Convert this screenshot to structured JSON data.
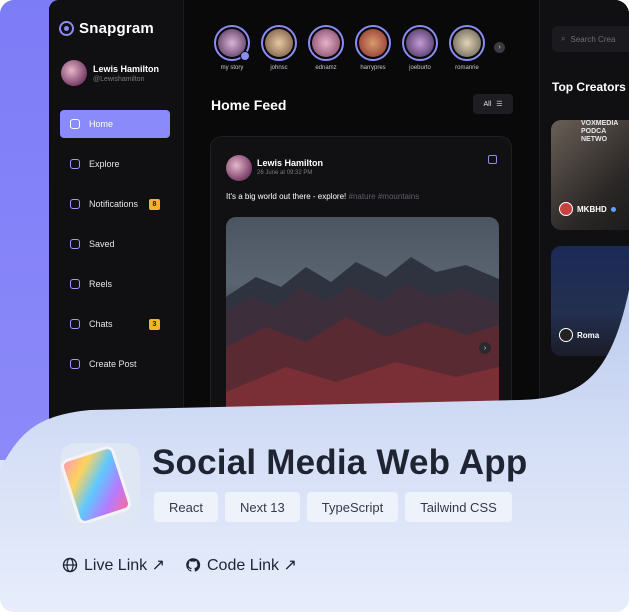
{
  "app": {
    "brand": "Snapgram",
    "profile": {
      "name": "Lewis Hamilton",
      "handle": "@Lewishamilton"
    },
    "nav": [
      {
        "label": "Home",
        "active": true,
        "badge": ""
      },
      {
        "label": "Explore",
        "active": false,
        "badge": ""
      },
      {
        "label": "Notifications",
        "active": false,
        "badge": "8"
      },
      {
        "label": "Saved",
        "active": false,
        "badge": ""
      },
      {
        "label": "Reels",
        "active": false,
        "badge": ""
      },
      {
        "label": "Chats",
        "active": false,
        "badge": "3"
      },
      {
        "label": "Create Post",
        "active": false,
        "badge": ""
      }
    ],
    "stories": [
      "my story",
      "johnsc",
      "ednamz",
      "harrypres",
      "joeburto",
      "romanrie"
    ],
    "feed_title": "Home Feed",
    "filter_label": "All",
    "post": {
      "author": "Lewis Hamilton",
      "date": "26 June at 09:32 PM",
      "text": "It's a big world out there - explore!",
      "tags": "#nature #mountains"
    },
    "search_placeholder": "Search Crea",
    "top_creators": "Top Creators",
    "creators": [
      {
        "name": "MKBHD",
        "overlay": "VOXMEDIA\nPODCA\nNETWO"
      },
      {
        "name": "Roma",
        "overlay": ""
      }
    ]
  },
  "project": {
    "title": "Social Media Web App",
    "tags": [
      "React",
      "Next 13",
      "TypeScript",
      "Tailwind CSS"
    ],
    "links": {
      "live": "Live Link ↗",
      "code": "Code Link ↗"
    }
  },
  "colors": {
    "accent": "#8a8afa",
    "badge": "#f4b22e",
    "panel": "#d3def6"
  }
}
